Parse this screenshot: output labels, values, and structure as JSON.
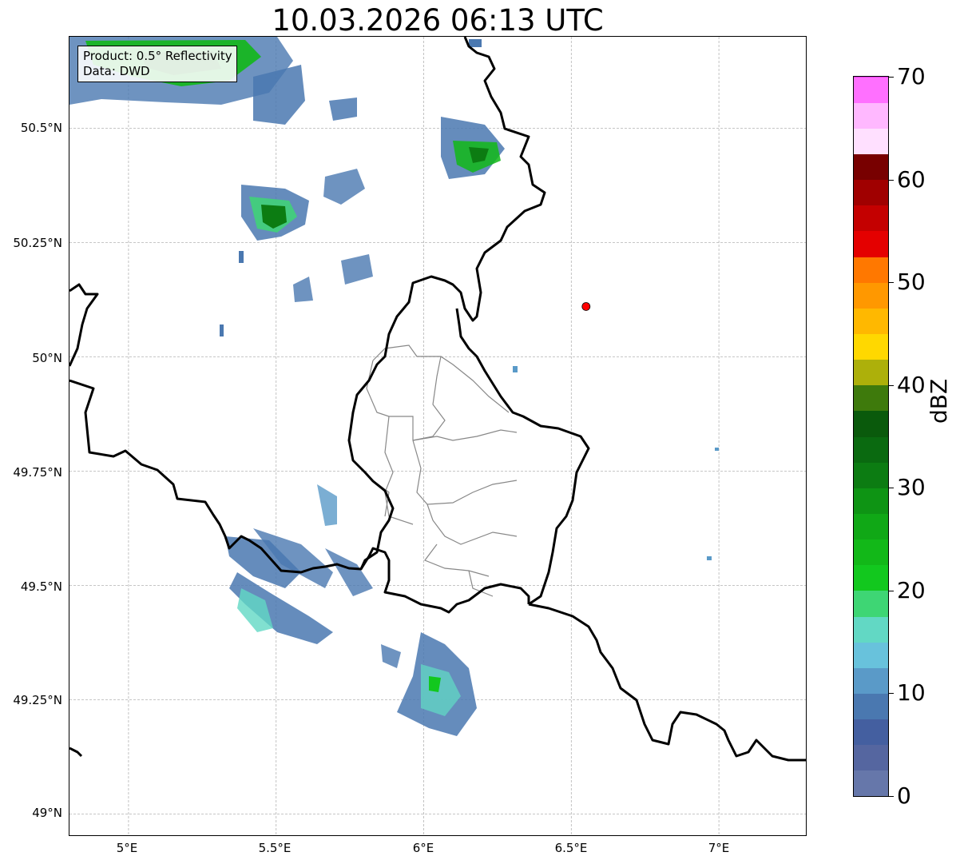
{
  "title": "10.03.2026 06:13 UTC",
  "info": {
    "product": "Product: 0.5° Reflectivity",
    "source": "Data: DWD"
  },
  "lat_ticks": [
    "50.5°N",
    "50.25°N",
    "50°N",
    "49.75°N",
    "49.5°N",
    "49.25°N",
    "49°N"
  ],
  "lon_ticks": [
    "5°E",
    "5.5°E",
    "6°E",
    "6.5°E",
    "7°E"
  ],
  "extent": {
    "lon_min": 4.8,
    "lon_max": 7.3,
    "lat_min": 48.95,
    "lat_max": 50.7
  },
  "radar_site": {
    "lon": 6.55,
    "lat": 50.11,
    "color": "#ff0000"
  },
  "colorbar": {
    "label": "dBZ",
    "ticks": [
      "0",
      "10",
      "20",
      "30",
      "40",
      "50",
      "60",
      "70"
    ],
    "range": [
      0,
      70
    ],
    "step": 2.5,
    "colors": [
      "#6677aa",
      "#5566a0",
      "#445fa0",
      "#4a78b0",
      "#5a9ac8",
      "#68c2dc",
      "#62d8c4",
      "#3ed674",
      "#12c81e",
      "#12b818",
      "#10a816",
      "#0e9414",
      "#0c7c12",
      "#0a6a10",
      "#0a5a0c",
      "#3e7a0c",
      "#adb00a",
      "#ffd800",
      "#ffb800",
      "#ff9800",
      "#ff7800",
      "#e40000",
      "#c40000",
      "#a00000",
      "#780000",
      "#ffe0ff",
      "#ffb8ff",
      "#ff70ff",
      "#e838f0"
    ]
  },
  "colors": {
    "border": "#000000",
    "admin": "#888888",
    "grid": "#b4b4b4"
  }
}
